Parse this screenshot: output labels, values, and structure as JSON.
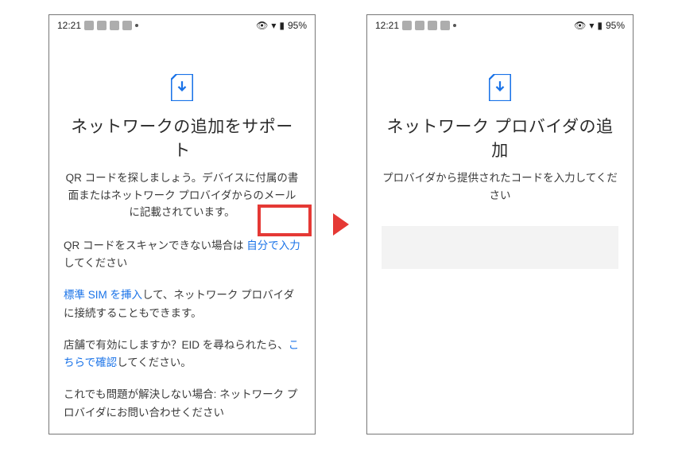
{
  "status_bar": {
    "time": "12:21",
    "battery_text": "95%"
  },
  "left_screen": {
    "title": "ネットワークの追加をサポート",
    "subtitle": "QR コードを探しましょう。デバイスに付属の書面またはネットワーク プロバイダからのメールに記載されています。",
    "p1_a": "QR コードをスキャンできない場合は",
    "p1_link": "自分で入力",
    "p1_b": "してください",
    "p2_link": "標準 SIM を挿入",
    "p2_b": "して、ネットワーク プロバイダに接続することもできます。",
    "p3_a": "店舗で有効にしますか？EID を尋ねられたら、",
    "p3_link": "こちらで確認",
    "p3_b": "してください。",
    "p4": "これでも問題が解決しない場合: ネットワーク プロバイダにお問い合わせください"
  },
  "right_screen": {
    "title": "ネットワーク プロバイダの追加",
    "subtitle": "プロバイダから提供されたコードを入力してください"
  }
}
